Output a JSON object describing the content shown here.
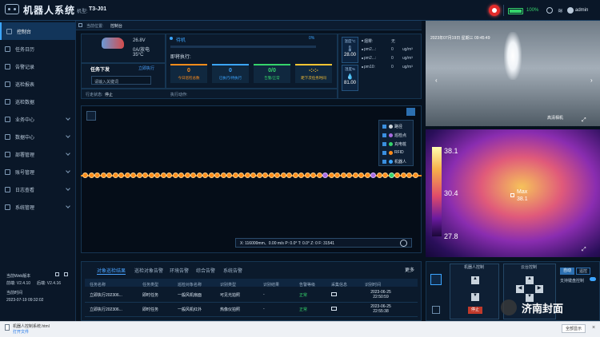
{
  "header": {
    "app_title": "机器人系统",
    "model_label": "机型:",
    "model_value": "T3-J01",
    "battery_text": "100%",
    "user_name": "admin",
    "colors": {
      "accent": "#3ca5ff",
      "alarm": "#e32b2b",
      "battery": "#35d46b"
    }
  },
  "sidebar": {
    "items": [
      {
        "label": "控制台",
        "active": true
      },
      {
        "label": "任务日历"
      },
      {
        "label": "告警记录"
      },
      {
        "label": "巡检报表"
      },
      {
        "label": "巡检数据"
      },
      {
        "label": "业务中心",
        "expand": true
      },
      {
        "label": "数据中心",
        "expand": true
      },
      {
        "label": "部署管理",
        "expand": true
      },
      {
        "label": "账号管理",
        "expand": true
      },
      {
        "label": "日志查看",
        "expand": true
      },
      {
        "label": "系统管理",
        "expand": true
      }
    ],
    "version": {
      "web_label": "当前Web版本",
      "front_label": "前端:",
      "front_value": "V2.4.10",
      "back_label": "后端:",
      "back_value": "V2.4.16",
      "time_label": "当前时间",
      "time_value": "2023-07-19 09:32:02"
    }
  },
  "breadcrumb": {
    "label": "当前位置:",
    "value": "控制台"
  },
  "robot_status": {
    "speed": "26.8V",
    "current": "0A/放电",
    "temp": "35°C",
    "task_state": "待机",
    "progress_pct": "0%",
    "executing_label": "即将执行:",
    "run_state_label": "行走状态:",
    "run_state_value": "停止",
    "action_label": "执行动作:"
  },
  "task": {
    "title": "任务下发",
    "link": "立即执行",
    "input_placeholder": "请输入关键词"
  },
  "cards": [
    {
      "value": "0",
      "label": "今日巡检总数",
      "color": "#ff8c1a"
    },
    {
      "value": "0",
      "label": "已执行/待执行",
      "color": "#3ca5ff"
    },
    {
      "value": "0/0",
      "label": "告警/正常",
      "color": "#35d46b"
    },
    {
      "value": "-:-:-",
      "label": "距下次任务时间",
      "color": "#ffc533"
    }
  ],
  "env": {
    "temp_label": "温度°C",
    "temp_value": "28.00",
    "humidity_label": "湿度%",
    "humidity_value": "81.00",
    "sensors": [
      {
        "name": "烟雾:",
        "value": "无",
        "unit": ""
      },
      {
        "name": "pm2...:",
        "value": "0",
        "unit": "ug/m³"
      },
      {
        "name": "pm2...:",
        "value": "0",
        "unit": "ug/m³"
      },
      {
        "name": "pm10:",
        "value": "0",
        "unit": "ug/m³"
      }
    ]
  },
  "map": {
    "legend": [
      {
        "label": "路径",
        "color": "#cfd6dd"
      },
      {
        "label": "巡检点",
        "color": "#a86be0"
      },
      {
        "label": "充电桩",
        "color": "#35d46b"
      },
      {
        "label": "RFID",
        "color": "#ff8c1a"
      },
      {
        "label": "机器人",
        "color": "#3ca5ff"
      }
    ],
    "status_text": "X: 116000mm、0.00 m/s  P: 0.0°  T: 0.0°  Z: 0  F: 31541"
  },
  "video": {
    "timestamp": "2023年07月19日 星期三 09:45:49",
    "caption": "高清相机"
  },
  "thermal": {
    "scale_max": "38.1",
    "scale_mid": "30.4",
    "scale_min": "27.8",
    "max_label": "Max",
    "max_value": "38.1"
  },
  "bottom": {
    "tabs": [
      "对象巡检结果",
      "巡检对象告警",
      "环境告警",
      "综合告警",
      "系统告警"
    ],
    "more": "更多",
    "headers": [
      "任务名称",
      "任务类型",
      "巡检对象名称",
      "识别类型",
      "识别结果",
      "告警等级",
      "采集信息",
      "识别时间"
    ],
    "rows": [
      {
        "name": "立即执行202306...",
        "type": "即时任务",
        "obj": "一般风机扇面",
        "rtype": "可见光拍照",
        "result": "-",
        "level": "正常",
        "time": "2023-06-25 22:50:59"
      },
      {
        "name": "立即执行202306...",
        "type": "即时任务",
        "obj": "一般风机红外",
        "rtype": "热像仪拍照",
        "result": "-",
        "level": "正常",
        "time": "2023-06-25 22:55:38"
      }
    ]
  },
  "controls": {
    "robot_control": "机器人控制",
    "ptz_control": "云台控制",
    "auto_label": "自动",
    "manual_label": "遥控",
    "kbd_label": "支持键盘控制",
    "stop_label": "停止"
  },
  "download": {
    "file_name": "机器人控制系统.html",
    "open_link": "打开文件",
    "button": "全部显示"
  },
  "watermark": "济南封面"
}
